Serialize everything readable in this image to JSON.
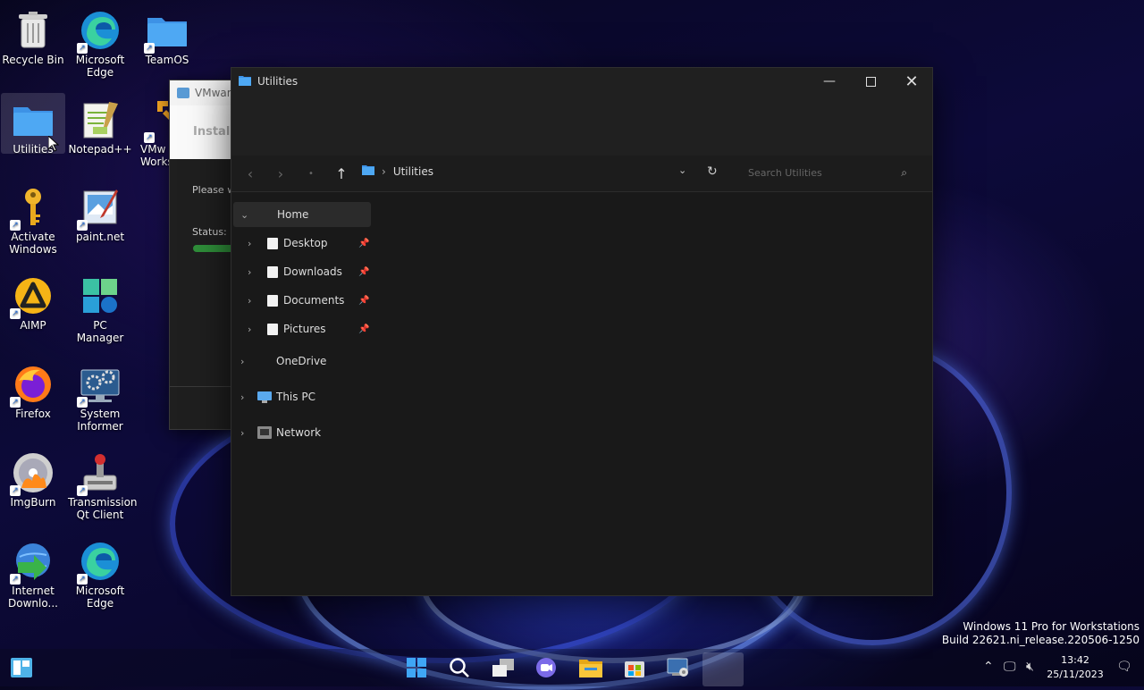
{
  "desktop": {
    "icons": [
      {
        "label": "Recycle Bin"
      },
      {
        "label": "Microsoft Edge"
      },
      {
        "label": "TeamOS"
      },
      {
        "label": "Utilities"
      },
      {
        "label": "Notepad++"
      },
      {
        "label": "VMware Workstation"
      },
      {
        "label": "Activate Windows"
      },
      {
        "label": "paint.net"
      },
      {
        "label": "AIMP"
      },
      {
        "label": "PC Manager"
      },
      {
        "label": "Firefox"
      },
      {
        "label": "System Informer"
      },
      {
        "label": "ImgBurn"
      },
      {
        "label": "Transmission Qt Client"
      },
      {
        "label": "Internet Downlo..."
      },
      {
        "label": "Microsoft Edge"
      }
    ],
    "edge_labels": {
      "vmw_a": "VMw",
      "vmw_b": "Works"
    }
  },
  "vmware_window": {
    "title": "VMware",
    "heading": "Installi",
    "body": "Please w",
    "status_label": "Status:"
  },
  "explorer": {
    "title": "Utilities",
    "breadcrumb": "Utilities",
    "search_placeholder": "Search Utilities",
    "nav": {
      "home": "Home",
      "quick_access": [
        {
          "label": "Desktop"
        },
        {
          "label": "Downloads"
        },
        {
          "label": "Documents"
        },
        {
          "label": "Pictures"
        }
      ],
      "onedrive": "OneDrive",
      "this_pc": "This PC",
      "network": "Network"
    }
  },
  "watermark": {
    "line1": "Windows 11 Pro for Workstations",
    "line2": "Build 22621.ni_release.220506-1250"
  },
  "clock": {
    "time": "13:42",
    "date": "25/11/2023"
  },
  "colors": {
    "accent": "#2f7fe0",
    "folder": "#4aa3f0",
    "progress": "#2f8f3a"
  }
}
